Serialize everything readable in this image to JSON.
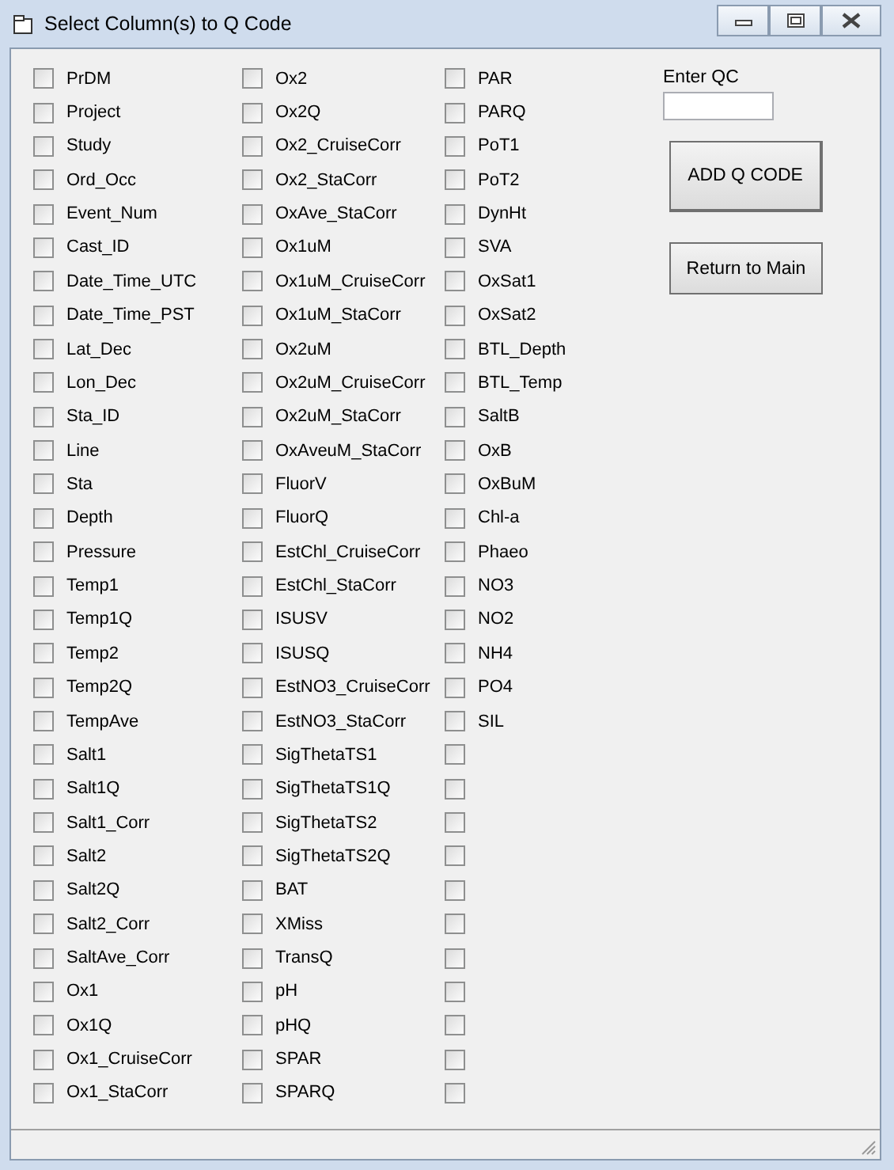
{
  "window": {
    "title": "Select Column(s) to Q Code"
  },
  "columns": [
    {
      "items": [
        {
          "label": "PrDM",
          "checked": false
        },
        {
          "label": "Project",
          "checked": false
        },
        {
          "label": "Study",
          "checked": false
        },
        {
          "label": "Ord_Occ",
          "checked": false
        },
        {
          "label": "Event_Num",
          "checked": false
        },
        {
          "label": "Cast_ID",
          "checked": false
        },
        {
          "label": "Date_Time_UTC",
          "checked": false
        },
        {
          "label": "Date_Time_PST",
          "checked": false
        },
        {
          "label": "Lat_Dec",
          "checked": false
        },
        {
          "label": "Lon_Dec",
          "checked": false
        },
        {
          "label": "Sta_ID",
          "checked": false
        },
        {
          "label": "Line",
          "checked": false
        },
        {
          "label": "Sta",
          "checked": false
        },
        {
          "label": "Depth",
          "checked": false
        },
        {
          "label": "Pressure",
          "checked": false
        },
        {
          "label": "Temp1",
          "checked": false
        },
        {
          "label": "Temp1Q",
          "checked": false
        },
        {
          "label": "Temp2",
          "checked": false
        },
        {
          "label": "Temp2Q",
          "checked": false
        },
        {
          "label": "TempAve",
          "checked": false
        },
        {
          "label": "Salt1",
          "checked": false
        },
        {
          "label": "Salt1Q",
          "checked": false
        },
        {
          "label": "Salt1_Corr",
          "checked": false
        },
        {
          "label": "Salt2",
          "checked": false
        },
        {
          "label": "Salt2Q",
          "checked": false
        },
        {
          "label": "Salt2_Corr",
          "checked": false
        },
        {
          "label": "SaltAve_Corr",
          "checked": false
        },
        {
          "label": "Ox1",
          "checked": false
        },
        {
          "label": "Ox1Q",
          "checked": false
        },
        {
          "label": "Ox1_CruiseCorr",
          "checked": false
        },
        {
          "label": "Ox1_StaCorr",
          "checked": false
        }
      ]
    },
    {
      "items": [
        {
          "label": "Ox2",
          "checked": false
        },
        {
          "label": "Ox2Q",
          "checked": false
        },
        {
          "label": "Ox2_CruiseCorr",
          "checked": false
        },
        {
          "label": "Ox2_StaCorr",
          "checked": false
        },
        {
          "label": "OxAve_StaCorr",
          "checked": false
        },
        {
          "label": "Ox1uM",
          "checked": false
        },
        {
          "label": "Ox1uM_CruiseCorr",
          "checked": false
        },
        {
          "label": "Ox1uM_StaCorr",
          "checked": false
        },
        {
          "label": "Ox2uM",
          "checked": false
        },
        {
          "label": "Ox2uM_CruiseCorr",
          "checked": false
        },
        {
          "label": "Ox2uM_StaCorr",
          "checked": false
        },
        {
          "label": "OxAveuM_StaCorr",
          "checked": false
        },
        {
          "label": "FluorV",
          "checked": false
        },
        {
          "label": "FluorQ",
          "checked": false
        },
        {
          "label": "EstChl_CruiseCorr",
          "checked": false
        },
        {
          "label": "EstChl_StaCorr",
          "checked": false
        },
        {
          "label": "ISUSV",
          "checked": false
        },
        {
          "label": "ISUSQ",
          "checked": false
        },
        {
          "label": "EstNO3_CruiseCorr",
          "checked": false
        },
        {
          "label": "EstNO3_StaCorr",
          "checked": false
        },
        {
          "label": "SigThetaTS1",
          "checked": false
        },
        {
          "label": "SigThetaTS1Q",
          "checked": false
        },
        {
          "label": "SigThetaTS2",
          "checked": false
        },
        {
          "label": "SigThetaTS2Q",
          "checked": false
        },
        {
          "label": "BAT",
          "checked": false
        },
        {
          "label": "XMiss",
          "checked": false
        },
        {
          "label": "TransQ",
          "checked": false
        },
        {
          "label": "pH",
          "checked": false
        },
        {
          "label": "pHQ",
          "checked": false
        },
        {
          "label": "SPAR",
          "checked": false
        },
        {
          "label": "SPARQ",
          "checked": false
        }
      ]
    },
    {
      "items": [
        {
          "label": "PAR",
          "checked": false
        },
        {
          "label": "PARQ",
          "checked": false
        },
        {
          "label": "PoT1",
          "checked": false
        },
        {
          "label": "PoT2",
          "checked": false
        },
        {
          "label": "DynHt",
          "checked": false
        },
        {
          "label": "SVA",
          "checked": false
        },
        {
          "label": "OxSat1",
          "checked": false
        },
        {
          "label": "OxSat2",
          "checked": false
        },
        {
          "label": "BTL_Depth",
          "checked": false
        },
        {
          "label": "BTL_Temp",
          "checked": false
        },
        {
          "label": "SaltB",
          "checked": false
        },
        {
          "label": "OxB",
          "checked": false
        },
        {
          "label": "OxBuM",
          "checked": false
        },
        {
          "label": "Chl-a",
          "checked": false
        },
        {
          "label": "Phaeo",
          "checked": false
        },
        {
          "label": "NO3",
          "checked": false
        },
        {
          "label": "NO2",
          "checked": false
        },
        {
          "label": "NH4",
          "checked": false
        },
        {
          "label": "PO4",
          "checked": false
        },
        {
          "label": "SIL",
          "checked": false
        },
        {
          "checked": false
        },
        {
          "checked": false
        },
        {
          "checked": false
        },
        {
          "checked": false
        },
        {
          "checked": false
        },
        {
          "checked": false
        },
        {
          "checked": false
        },
        {
          "checked": false
        },
        {
          "checked": false
        },
        {
          "checked": false
        },
        {
          "checked": false
        }
      ]
    }
  ],
  "qc_field": {
    "label": "Enter QC"
  },
  "buttons": [
    "ADD Q CODE",
    "Return to Main"
  ]
}
